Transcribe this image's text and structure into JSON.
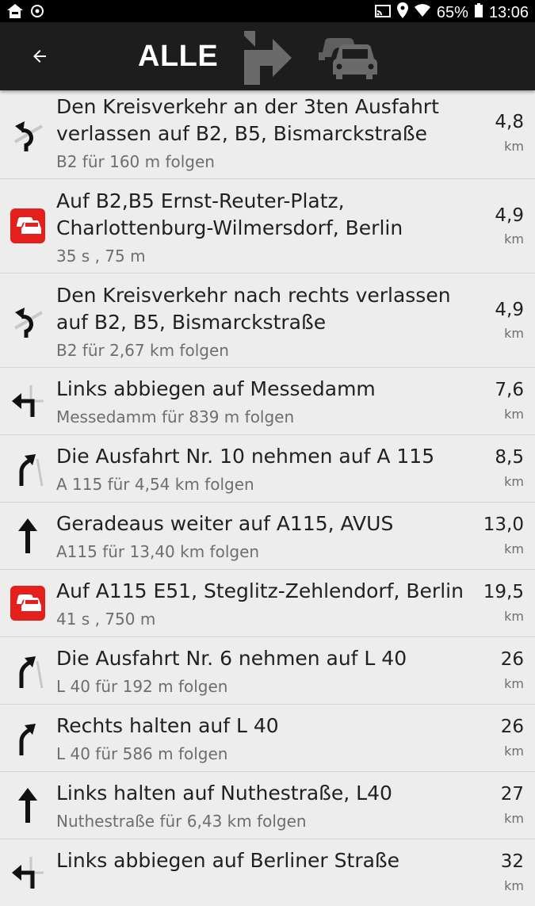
{
  "status_bar": {
    "left_icons": [
      "home-alert-icon",
      "sync-icon"
    ],
    "right_icons": [
      "cast-icon",
      "location-icon",
      "wifi-icon",
      "battery-icon"
    ],
    "battery": "65%",
    "time": "13:06"
  },
  "app_bar": {
    "back_icon": "arrow-left-icon",
    "title": "ALLE",
    "filters": [
      "turn-right-icon",
      "traffic-icon"
    ]
  },
  "accent_red": "#e3201b",
  "rows": [
    {
      "icon": "roundabout-icon",
      "title": "Den Kreisverkehr an der 3ten Ausfahrt verlassen auf B2, B5, Bismarckstraße",
      "sub": "B2 für 160 m folgen",
      "dist": "4,8",
      "unit": "km"
    },
    {
      "icon": "traffic-icon",
      "title": "Auf B2,B5 Ernst-Reuter-Platz, Charlottenburg-Wilmersdorf, Berlin",
      "sub": "35 s , 75 m",
      "dist": "4,9",
      "unit": "km"
    },
    {
      "icon": "roundabout-icon",
      "title": "Den Kreisverkehr nach rechts verlassen auf B2, B5, Bismarckstraße",
      "sub": "B2 für 2,67 km folgen",
      "dist": "4,9",
      "unit": "km"
    },
    {
      "icon": "turn-left-icon",
      "title": "Links abbiegen auf Messedamm",
      "sub": "Messedamm für 839 m folgen",
      "dist": "7,6",
      "unit": "km"
    },
    {
      "icon": "exit-right-icon",
      "title": "Die Ausfahrt Nr. 10 nehmen auf A 115",
      "sub": "A 115 für 4,54 km folgen",
      "dist": "8,5",
      "unit": "km"
    },
    {
      "icon": "straight-icon",
      "title": "Geradeaus weiter auf A115, AVUS",
      "sub": "A115 für 13,40 km folgen",
      "dist": "13,0",
      "unit": "km"
    },
    {
      "icon": "traffic-icon",
      "title": "Auf A115 E51, Steglitz-Zehlendorf, Berlin",
      "sub": "41 s , 750 m",
      "dist": "19,5",
      "unit": "km"
    },
    {
      "icon": "exit-right-icon",
      "title": "Die Ausfahrt Nr. 6 nehmen auf L 40",
      "sub": "L 40 für 192 m folgen",
      "dist": "26",
      "unit": "km"
    },
    {
      "icon": "exit-right-icon",
      "title": "Rechts halten auf L 40",
      "sub": "L 40 für 586 m folgen",
      "dist": "26",
      "unit": "km"
    },
    {
      "icon": "straight-icon",
      "title": "Links halten auf Nuthestraße, L40",
      "sub": "Nuthestraße für 6,43 km folgen",
      "dist": "27",
      "unit": "km"
    },
    {
      "icon": "turn-left-icon",
      "title": "Links abbiegen auf Berliner Straße",
      "sub": "",
      "dist": "32",
      "unit": "km"
    }
  ]
}
